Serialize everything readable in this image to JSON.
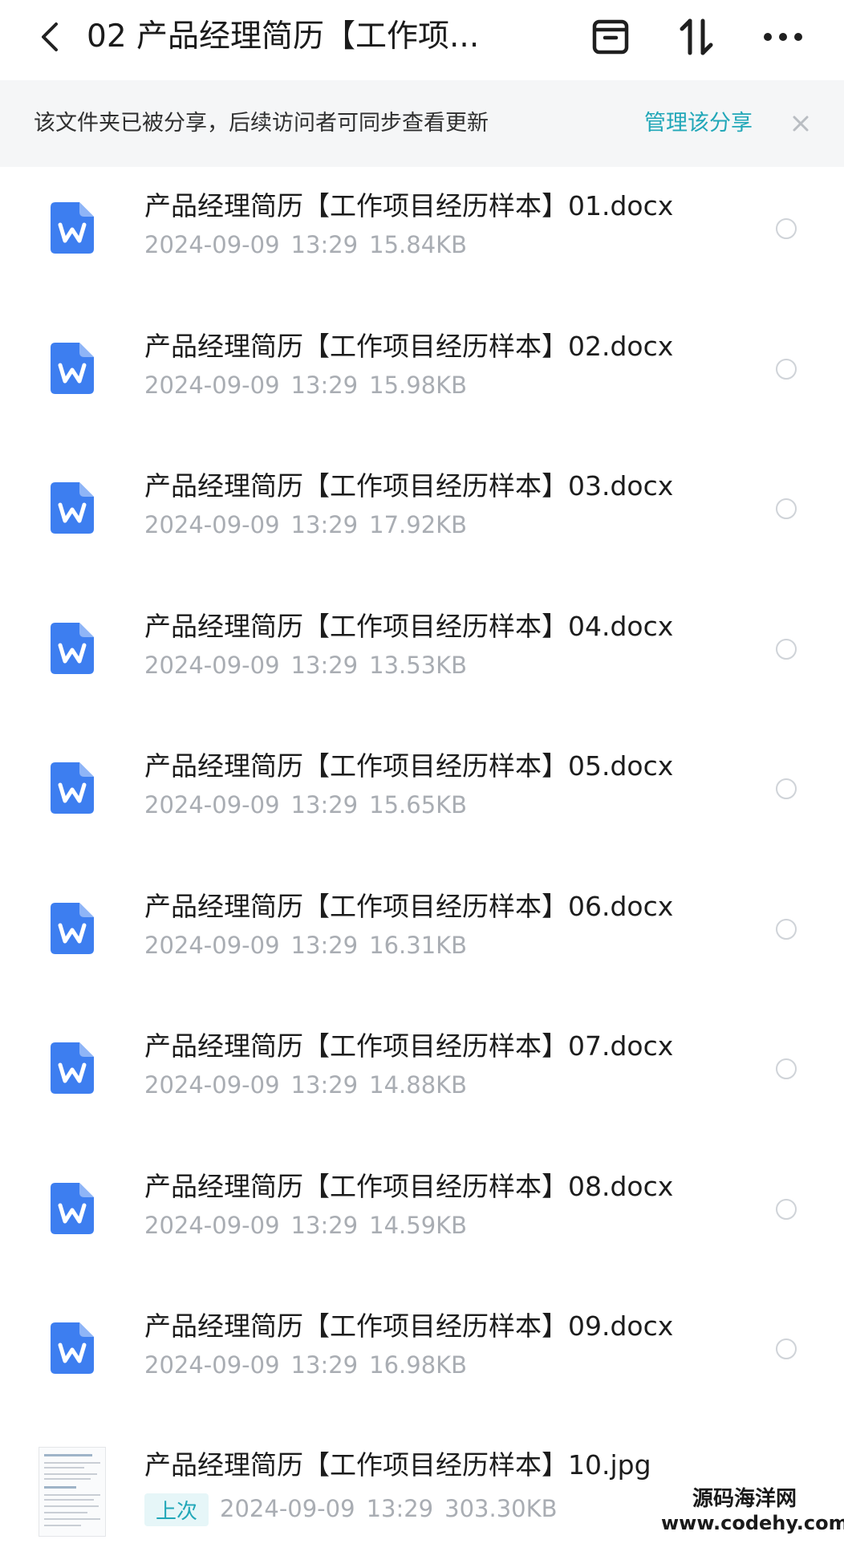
{
  "header": {
    "title": "02 产品经理简历【工作项...",
    "back_icon": "chevron-left-icon",
    "archive_icon": "archive-box-icon",
    "sort_icon": "sort-arrows-icon",
    "more_icon": "more-dots-icon"
  },
  "share_banner": {
    "text": "该文件夹已被分享，后续访问者可同步查看更新",
    "action": "管理该分享",
    "close_icon": "close-icon"
  },
  "colors": {
    "accent": "#21a7b8",
    "word_icon": "#3d7ef0",
    "meta_text": "#a9adb3"
  },
  "files": [
    {
      "name": "产品经理简历【工作项目经历样本】01.docx",
      "date": "2024-09-09",
      "time": "13:29",
      "size": "15.84KB",
      "icon": "word-doc-icon"
    },
    {
      "name": "产品经理简历【工作项目经历样本】02.docx",
      "date": "2024-09-09",
      "time": "13:29",
      "size": "15.98KB",
      "icon": "word-doc-icon"
    },
    {
      "name": "产品经理简历【工作项目经历样本】03.docx",
      "date": "2024-09-09",
      "time": "13:29",
      "size": "17.92KB",
      "icon": "word-doc-icon"
    },
    {
      "name": "产品经理简历【工作项目经历样本】04.docx",
      "date": "2024-09-09",
      "time": "13:29",
      "size": "13.53KB",
      "icon": "word-doc-icon"
    },
    {
      "name": "产品经理简历【工作项目经历样本】05.docx",
      "date": "2024-09-09",
      "time": "13:29",
      "size": "15.65KB",
      "icon": "word-doc-icon"
    },
    {
      "name": "产品经理简历【工作项目经历样本】06.docx",
      "date": "2024-09-09",
      "time": "13:29",
      "size": "16.31KB",
      "icon": "word-doc-icon"
    },
    {
      "name": "产品经理简历【工作项目经历样本】07.docx",
      "date": "2024-09-09",
      "time": "13:29",
      "size": "14.88KB",
      "icon": "word-doc-icon"
    },
    {
      "name": "产品经理简历【工作项目经历样本】08.docx",
      "date": "2024-09-09",
      "time": "13:29",
      "size": "14.59KB",
      "icon": "word-doc-icon"
    },
    {
      "name": "产品经理简历【工作项目经历样本】09.docx",
      "date": "2024-09-09",
      "time": "13:29",
      "size": "16.98KB",
      "icon": "word-doc-icon"
    }
  ],
  "last_file": {
    "name": "产品经理简历【工作项目经历样本】10.jpg",
    "tag": "上次",
    "date": "2024-09-09",
    "time": "13:29",
    "size": "303.30KB",
    "icon": "image-thumbnail"
  },
  "watermark": {
    "line1": "源码海洋网",
    "line2": "www.codehy.com"
  }
}
